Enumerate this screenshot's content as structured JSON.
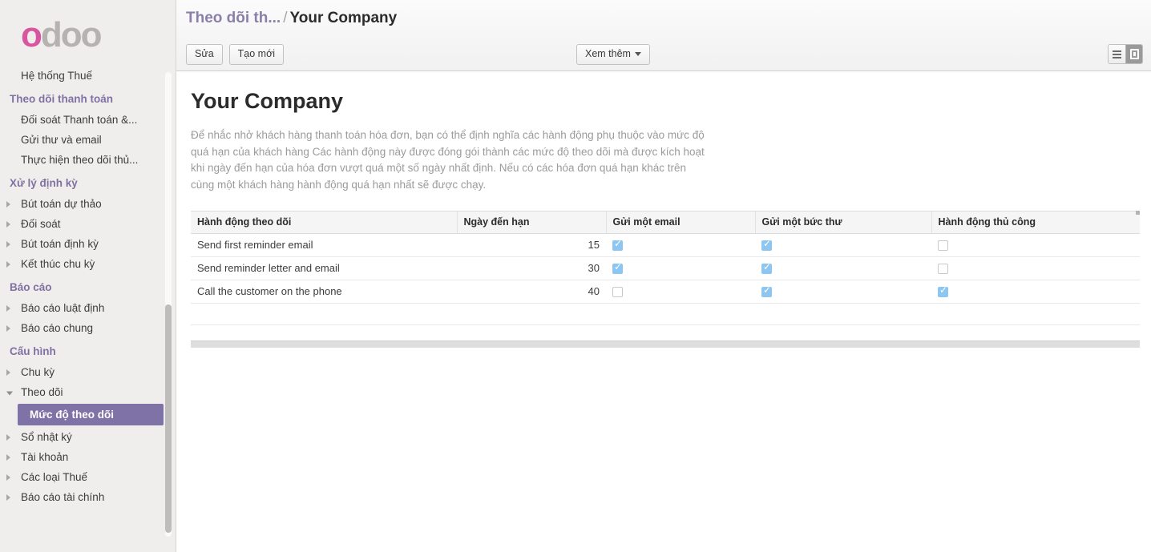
{
  "brand": {
    "logo_first": "o",
    "logo_rest": "doo",
    "pink": "#d8569f",
    "gray": "#b5b2b0",
    "accent_purple": "#7e72a6"
  },
  "sidebar": {
    "top_item": "Hệ thống Thuế",
    "groups": [
      {
        "section": "Theo dõi thanh toán",
        "items": [
          {
            "label": "Đối soát Thanh toán &...",
            "arrow": "none"
          },
          {
            "label": "Gửi thư và email",
            "arrow": "none"
          },
          {
            "label": "Thực hiện theo dõi thủ...",
            "arrow": "none"
          }
        ]
      },
      {
        "section": "Xử lý định kỳ",
        "items": [
          {
            "label": "Bút toán dự thảo",
            "arrow": "closed"
          },
          {
            "label": "Đối soát",
            "arrow": "closed"
          },
          {
            "label": "Bút toán định kỳ",
            "arrow": "closed"
          },
          {
            "label": "Kết thúc chu kỳ",
            "arrow": "closed"
          }
        ]
      },
      {
        "section": "Báo cáo",
        "items": [
          {
            "label": "Báo cáo luật định",
            "arrow": "closed"
          },
          {
            "label": "Báo cáo chung",
            "arrow": "closed"
          }
        ]
      },
      {
        "section": "Cấu hình",
        "items": [
          {
            "label": "Chu kỳ",
            "arrow": "closed"
          },
          {
            "label": "Theo dõi",
            "arrow": "open"
          }
        ]
      }
    ],
    "selected_child": "Mức độ theo dõi",
    "tail_items": [
      {
        "label": "Sổ nhật ký",
        "arrow": "closed"
      },
      {
        "label": "Tài khoản",
        "arrow": "closed"
      },
      {
        "label": "Các loại Thuế",
        "arrow": "closed"
      },
      {
        "label": "Báo cáo tài chính",
        "arrow": "closed"
      }
    ]
  },
  "header": {
    "breadcrumb_parent": "Theo dõi th...",
    "breadcrumb_sep": "/",
    "breadcrumb_current": "Your Company",
    "edit_label": "Sửa",
    "create_label": "Tạo mới",
    "more_label": "Xem thêm",
    "view_list_icon": "list-view-icon",
    "view_form_icon": "form-view-icon"
  },
  "content": {
    "title": "Your Company",
    "description": "Để nhắc nhở khách hàng thanh toán hóa đơn, bạn có thể định nghĩa các hành động phụ thuộc vào mức độ quá hạn của khách hàng Các hành động này được đóng gói thành các mức độ theo dõi mà được kích hoạt khi ngày đến hạn của hóa đơn vượt quá một số ngày nhất định. Nếu có các hóa đơn quá hạn khác trên cùng một khách hàng hành động quá hạn nhất sẽ được chạy."
  },
  "table": {
    "columns": [
      "Hành động theo dõi",
      "Ngày đến hạn",
      "Gửi một email",
      "Gửi một bức thư",
      "Hành động thủ công"
    ],
    "rows": [
      {
        "action": "Send first reminder email",
        "due_days": "15",
        "send_email": true,
        "send_letter": true,
        "manual_action": false
      },
      {
        "action": "Send reminder letter and email",
        "due_days": "30",
        "send_email": true,
        "send_letter": true,
        "manual_action": false
      },
      {
        "action": "Call the customer on the phone",
        "due_days": "40",
        "send_email": false,
        "send_letter": true,
        "manual_action": true
      }
    ],
    "checkbox_on_color": "#8ec6f2"
  }
}
